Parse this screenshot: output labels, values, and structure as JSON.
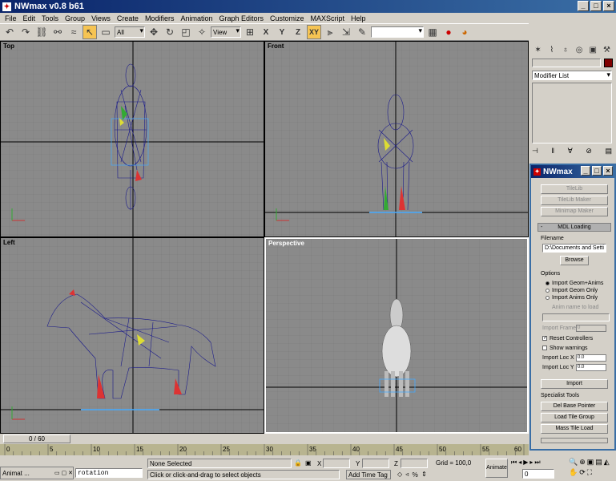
{
  "window": {
    "title": "NWmax v0.8 b61",
    "logo": "3ds-max-logo-icon"
  },
  "menu": [
    "File",
    "Edit",
    "Tools",
    "Group",
    "Views",
    "Create",
    "Modifiers",
    "Animation",
    "Graph Editors",
    "Customize",
    "MAXScript",
    "Help"
  ],
  "toolbar": {
    "selection_filter": "All",
    "ref_coord": "View",
    "constraint_xy": "XY"
  },
  "viewports": [
    {
      "label": "Top"
    },
    {
      "label": "Front"
    },
    {
      "label": "Left"
    },
    {
      "label": "Perspective"
    }
  ],
  "command_panel": {
    "modifier_list": "Modifier List",
    "object_color": "#800000"
  },
  "nwmax": {
    "title": "NWmax",
    "buttons": {
      "tile_lib": "TileLib",
      "tile_lib_maker": "TileLib Maker",
      "minimap_maker": "Minimap Maker"
    },
    "rollout": "MDL Loading",
    "filename_label": "Filename",
    "filename_value": "D:\\Documents and Setti",
    "browse": "Browse",
    "options_label": "Options",
    "radio": [
      "Import Geom+Anims",
      "Import Geom Only",
      "Import Anims Only"
    ],
    "anim_name_label": "Anim name to load",
    "import_frame_label": "Import Frame",
    "import_frame_value": "0",
    "reset_controllers": "Reset Controllers",
    "show_warnings": "Show warnings",
    "import_loc_x": "Import Loc X",
    "import_loc_y": "Import Loc Y",
    "loc_x_value": "0.0",
    "loc_y_value": "0.0",
    "import_button": "Import",
    "specialist_label": "Specialist Tools",
    "specialist": [
      "Del Base Pointer",
      "Load Tile Group",
      "Mass Tile Load"
    ]
  },
  "timeline": {
    "frame": "0 / 60",
    "ticks": [
      "0",
      "5",
      "10",
      "15",
      "20",
      "25",
      "30",
      "35",
      "40",
      "45",
      "50",
      "55",
      "60"
    ]
  },
  "status": {
    "taskbar_label": "Animat ...",
    "listener": "rotation",
    "selection": "None Selected",
    "prompt": "Click or click-and-drag to select objects",
    "x_label": "X",
    "y_label": "Y",
    "z_label": "Z",
    "grid": "Grid = 100,0",
    "add_time_tag": "Add Time Tag",
    "animate": "Animate",
    "frame": "0"
  }
}
